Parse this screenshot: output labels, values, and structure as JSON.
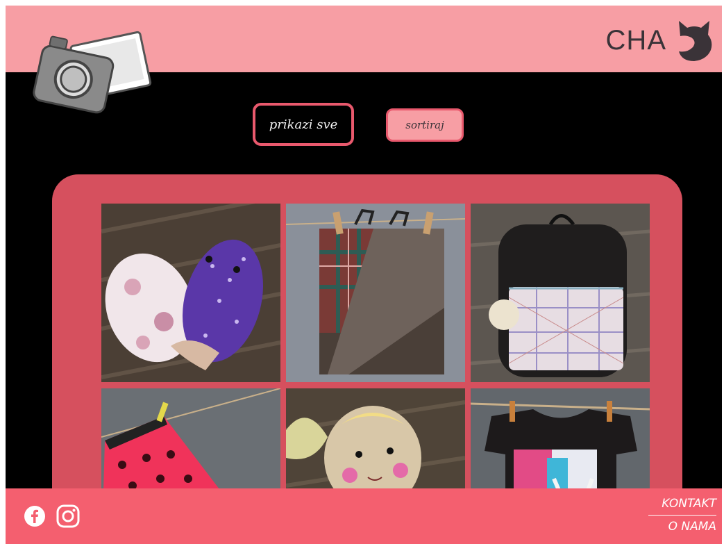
{
  "header": {
    "brand_text": "CHA",
    "brand_logo_icon": "cat-head-icon",
    "site_logo_icon": "camera-photo-icon"
  },
  "controls": {
    "show_all_label": "prikazi sve",
    "sort_label": "sortiraj"
  },
  "gallery": {
    "items": [
      {
        "subject": "plush-cats-photo"
      },
      {
        "subject": "plaid-bag-photo"
      },
      {
        "subject": "black-backpack-photo"
      },
      {
        "subject": "polka-dot-skirt-photo"
      },
      {
        "subject": "rag-doll-photo"
      },
      {
        "subject": "printed-tshirt-photo"
      }
    ]
  },
  "footer": {
    "social": [
      "facebook-icon",
      "instagram-icon"
    ],
    "links": {
      "contact": "KONTAKT",
      "about": "O NAMA"
    }
  },
  "colors": {
    "header_bg": "#f79ea4",
    "page_bg": "#000000",
    "panel_bg": "#d6505e",
    "footer_bg": "#f45f6f",
    "accent": "#e9596d"
  }
}
